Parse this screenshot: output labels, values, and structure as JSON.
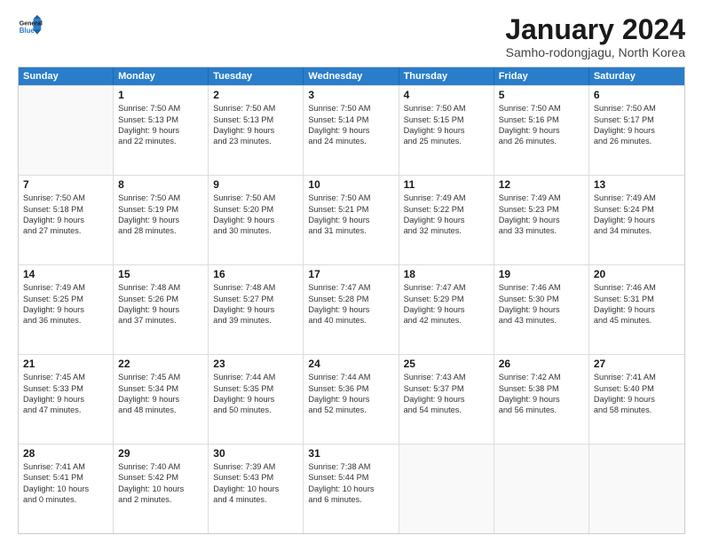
{
  "logo": {
    "line1": "General",
    "line2": "Blue"
  },
  "title": "January 2024",
  "subtitle": "Samho-rodongjagu, North Korea",
  "header_days": [
    "Sunday",
    "Monday",
    "Tuesday",
    "Wednesday",
    "Thursday",
    "Friday",
    "Saturday"
  ],
  "rows": [
    [
      {
        "day": "",
        "lines": []
      },
      {
        "day": "1",
        "lines": [
          "Sunrise: 7:50 AM",
          "Sunset: 5:13 PM",
          "Daylight: 9 hours",
          "and 22 minutes."
        ]
      },
      {
        "day": "2",
        "lines": [
          "Sunrise: 7:50 AM",
          "Sunset: 5:13 PM",
          "Daylight: 9 hours",
          "and 23 minutes."
        ]
      },
      {
        "day": "3",
        "lines": [
          "Sunrise: 7:50 AM",
          "Sunset: 5:14 PM",
          "Daylight: 9 hours",
          "and 24 minutes."
        ]
      },
      {
        "day": "4",
        "lines": [
          "Sunrise: 7:50 AM",
          "Sunset: 5:15 PM",
          "Daylight: 9 hours",
          "and 25 minutes."
        ]
      },
      {
        "day": "5",
        "lines": [
          "Sunrise: 7:50 AM",
          "Sunset: 5:16 PM",
          "Daylight: 9 hours",
          "and 26 minutes."
        ]
      },
      {
        "day": "6",
        "lines": [
          "Sunrise: 7:50 AM",
          "Sunset: 5:17 PM",
          "Daylight: 9 hours",
          "and 26 minutes."
        ]
      }
    ],
    [
      {
        "day": "7",
        "lines": [
          "Sunrise: 7:50 AM",
          "Sunset: 5:18 PM",
          "Daylight: 9 hours",
          "and 27 minutes."
        ]
      },
      {
        "day": "8",
        "lines": [
          "Sunrise: 7:50 AM",
          "Sunset: 5:19 PM",
          "Daylight: 9 hours",
          "and 28 minutes."
        ]
      },
      {
        "day": "9",
        "lines": [
          "Sunrise: 7:50 AM",
          "Sunset: 5:20 PM",
          "Daylight: 9 hours",
          "and 30 minutes."
        ]
      },
      {
        "day": "10",
        "lines": [
          "Sunrise: 7:50 AM",
          "Sunset: 5:21 PM",
          "Daylight: 9 hours",
          "and 31 minutes."
        ]
      },
      {
        "day": "11",
        "lines": [
          "Sunrise: 7:49 AM",
          "Sunset: 5:22 PM",
          "Daylight: 9 hours",
          "and 32 minutes."
        ]
      },
      {
        "day": "12",
        "lines": [
          "Sunrise: 7:49 AM",
          "Sunset: 5:23 PM",
          "Daylight: 9 hours",
          "and 33 minutes."
        ]
      },
      {
        "day": "13",
        "lines": [
          "Sunrise: 7:49 AM",
          "Sunset: 5:24 PM",
          "Daylight: 9 hours",
          "and 34 minutes."
        ]
      }
    ],
    [
      {
        "day": "14",
        "lines": [
          "Sunrise: 7:49 AM",
          "Sunset: 5:25 PM",
          "Daylight: 9 hours",
          "and 36 minutes."
        ]
      },
      {
        "day": "15",
        "lines": [
          "Sunrise: 7:48 AM",
          "Sunset: 5:26 PM",
          "Daylight: 9 hours",
          "and 37 minutes."
        ]
      },
      {
        "day": "16",
        "lines": [
          "Sunrise: 7:48 AM",
          "Sunset: 5:27 PM",
          "Daylight: 9 hours",
          "and 39 minutes."
        ]
      },
      {
        "day": "17",
        "lines": [
          "Sunrise: 7:47 AM",
          "Sunset: 5:28 PM",
          "Daylight: 9 hours",
          "and 40 minutes."
        ]
      },
      {
        "day": "18",
        "lines": [
          "Sunrise: 7:47 AM",
          "Sunset: 5:29 PM",
          "Daylight: 9 hours",
          "and 42 minutes."
        ]
      },
      {
        "day": "19",
        "lines": [
          "Sunrise: 7:46 AM",
          "Sunset: 5:30 PM",
          "Daylight: 9 hours",
          "and 43 minutes."
        ]
      },
      {
        "day": "20",
        "lines": [
          "Sunrise: 7:46 AM",
          "Sunset: 5:31 PM",
          "Daylight: 9 hours",
          "and 45 minutes."
        ]
      }
    ],
    [
      {
        "day": "21",
        "lines": [
          "Sunrise: 7:45 AM",
          "Sunset: 5:33 PM",
          "Daylight: 9 hours",
          "and 47 minutes."
        ]
      },
      {
        "day": "22",
        "lines": [
          "Sunrise: 7:45 AM",
          "Sunset: 5:34 PM",
          "Daylight: 9 hours",
          "and 48 minutes."
        ]
      },
      {
        "day": "23",
        "lines": [
          "Sunrise: 7:44 AM",
          "Sunset: 5:35 PM",
          "Daylight: 9 hours",
          "and 50 minutes."
        ]
      },
      {
        "day": "24",
        "lines": [
          "Sunrise: 7:44 AM",
          "Sunset: 5:36 PM",
          "Daylight: 9 hours",
          "and 52 minutes."
        ]
      },
      {
        "day": "25",
        "lines": [
          "Sunrise: 7:43 AM",
          "Sunset: 5:37 PM",
          "Daylight: 9 hours",
          "and 54 minutes."
        ]
      },
      {
        "day": "26",
        "lines": [
          "Sunrise: 7:42 AM",
          "Sunset: 5:38 PM",
          "Daylight: 9 hours",
          "and 56 minutes."
        ]
      },
      {
        "day": "27",
        "lines": [
          "Sunrise: 7:41 AM",
          "Sunset: 5:40 PM",
          "Daylight: 9 hours",
          "and 58 minutes."
        ]
      }
    ],
    [
      {
        "day": "28",
        "lines": [
          "Sunrise: 7:41 AM",
          "Sunset: 5:41 PM",
          "Daylight: 10 hours",
          "and 0 minutes."
        ]
      },
      {
        "day": "29",
        "lines": [
          "Sunrise: 7:40 AM",
          "Sunset: 5:42 PM",
          "Daylight: 10 hours",
          "and 2 minutes."
        ]
      },
      {
        "day": "30",
        "lines": [
          "Sunrise: 7:39 AM",
          "Sunset: 5:43 PM",
          "Daylight: 10 hours",
          "and 4 minutes."
        ]
      },
      {
        "day": "31",
        "lines": [
          "Sunrise: 7:38 AM",
          "Sunset: 5:44 PM",
          "Daylight: 10 hours",
          "and 6 minutes."
        ]
      },
      {
        "day": "",
        "lines": []
      },
      {
        "day": "",
        "lines": []
      },
      {
        "day": "",
        "lines": []
      }
    ]
  ]
}
